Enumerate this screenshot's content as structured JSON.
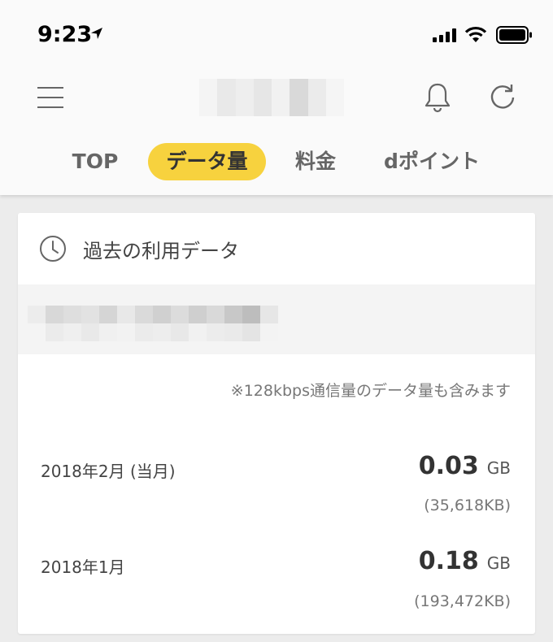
{
  "status_bar": {
    "time": "9:23",
    "icons": [
      "location-arrow-icon",
      "signal-icon",
      "wifi-icon",
      "battery-icon"
    ]
  },
  "nav": {
    "icons": [
      "hamburger-menu-icon",
      "bell-icon",
      "refresh-icon"
    ]
  },
  "tabs": [
    {
      "label": "TOP",
      "active": false
    },
    {
      "label": "データ量",
      "active": true
    },
    {
      "label": "料金",
      "active": false
    },
    {
      "label": "dポイント",
      "active": false
    }
  ],
  "colors": {
    "accent": "#f7d23e",
    "background": "#ececec",
    "card": "#ffffff"
  },
  "card": {
    "icon": "clock-icon",
    "title": "過去の利用データ",
    "note": "※128kbps通信量のデータ量も含みます",
    "entries": [
      {
        "label": "2018年2月 (当月)",
        "value": "0.03",
        "unit": "GB",
        "kb": "(35,618KB)"
      },
      {
        "label": "2018年1月",
        "value": "0.18",
        "unit": "GB",
        "kb": "(193,472KB)"
      }
    ]
  }
}
